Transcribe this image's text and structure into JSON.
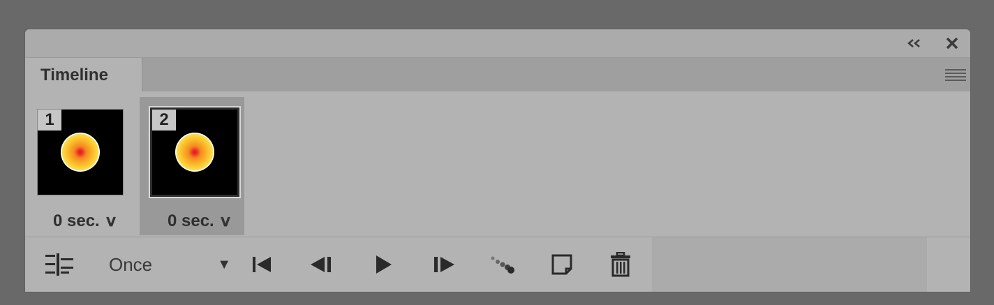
{
  "panel": {
    "collapse_icon": "double-chevron-left-icon",
    "close_icon": "close-icon",
    "menu_icon": "panel-menu-icon"
  },
  "tabs": [
    {
      "label": "Timeline"
    }
  ],
  "frames": [
    {
      "number": "1",
      "delay": "0 sec.",
      "selected": false
    },
    {
      "number": "2",
      "delay": "0 sec.",
      "selected": true
    }
  ],
  "toolbar": {
    "loop_option": "Once",
    "buttons": [
      "convert-to-video-timeline-icon",
      "select-first-frame-icon",
      "select-previous-frame-icon",
      "play-icon",
      "select-next-frame-icon",
      "tween-icon",
      "duplicate-frame-icon",
      "delete-frame-icon"
    ]
  },
  "colors": {
    "panel_bg": "#b3b3b3",
    "desktop_bg": "#696969",
    "selected_frame_bg": "#999999"
  }
}
